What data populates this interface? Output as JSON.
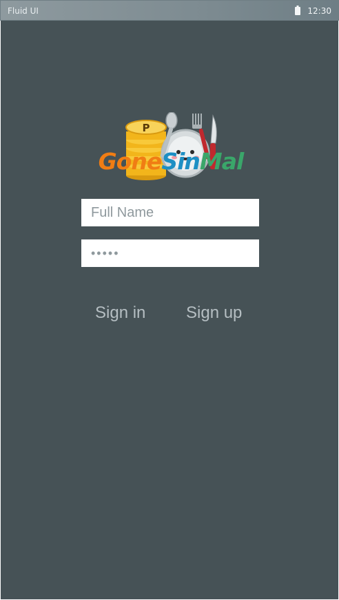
{
  "status_bar": {
    "title": "Fluid UI",
    "time": "12:30",
    "battery_icon": "battery-icon"
  },
  "logo": {
    "part1": "Gone",
    "part2": "Sin",
    "part3": "Mal",
    "colors": {
      "part1": "#f07d14",
      "part2": "#1d8fc4",
      "part3": "#3aa66a",
      "coin": "#f2b51b"
    },
    "icons": [
      "coin-stack-icon",
      "plate-mascot-icon",
      "spoon-icon",
      "fork-icon",
      "knife-icon"
    ]
  },
  "form": {
    "name_placeholder": "Full Name",
    "password_value": "•••••"
  },
  "actions": {
    "sign_in": "Sign in",
    "sign_up": "Sign up"
  },
  "colors": {
    "background": "#465256",
    "status_bar": "#8e9a9f",
    "link_text": "#b5bec2"
  }
}
